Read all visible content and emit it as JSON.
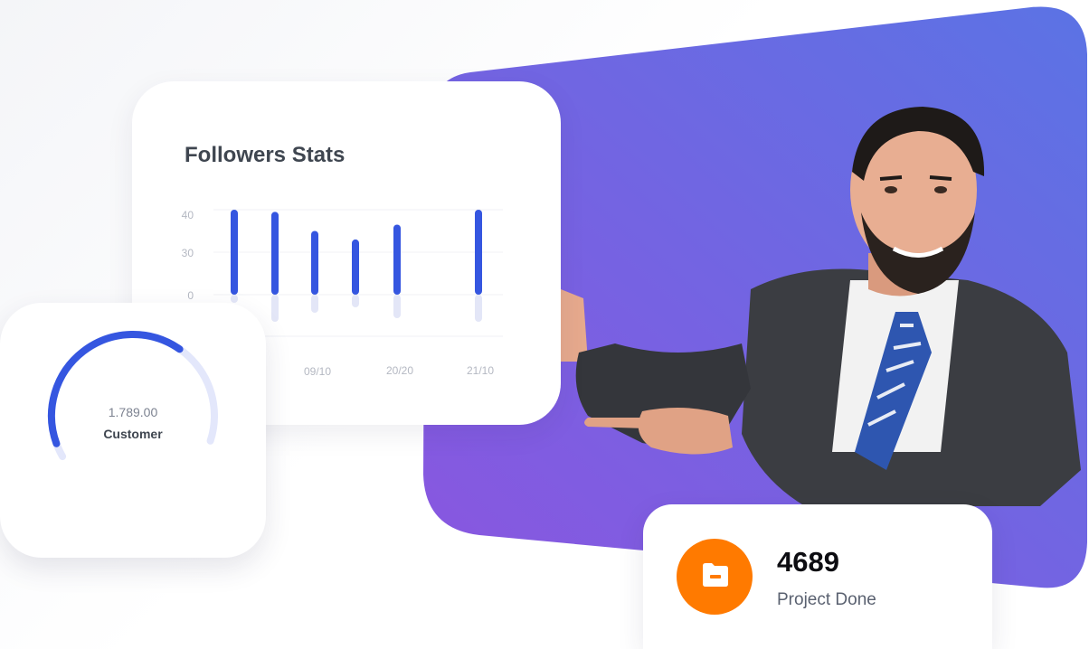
{
  "colors": {
    "panel_gradient_start": "#8a56e0",
    "panel_gradient_end": "#5b73e4",
    "bar_color": "#3556e0",
    "bar_shadow_color": "#e3e6f7",
    "gauge_fill": "#3556e0",
    "gauge_track": "#e3e7fb",
    "project_badge": "#ff7a00"
  },
  "followers_card": {
    "title": "Followers Stats",
    "y_tick_labels": [
      "40",
      "30",
      "0"
    ],
    "x_tick_labels": [
      "09/10",
      "20/20",
      "21/10"
    ]
  },
  "chart_data": {
    "type": "bar",
    "title": "Followers Stats",
    "xlabel": "",
    "ylabel": "",
    "categories": [
      "",
      "",
      "",
      "",
      "",
      ""
    ],
    "x_tick_labels": [
      "09/10",
      "20/20",
      "21/10"
    ],
    "values": [
      40,
      39,
      30,
      26,
      33,
      40
    ],
    "ylim": [
      0,
      40
    ],
    "yticks": [
      0,
      30,
      40
    ],
    "grid": true
  },
  "customer_card": {
    "value": "1.789.00",
    "label": "Customer",
    "gauge_fraction": 0.45,
    "icon": "gauge-ring"
  },
  "project_card": {
    "value": "4689",
    "label": "Project Done",
    "icon": "folder-icon"
  }
}
